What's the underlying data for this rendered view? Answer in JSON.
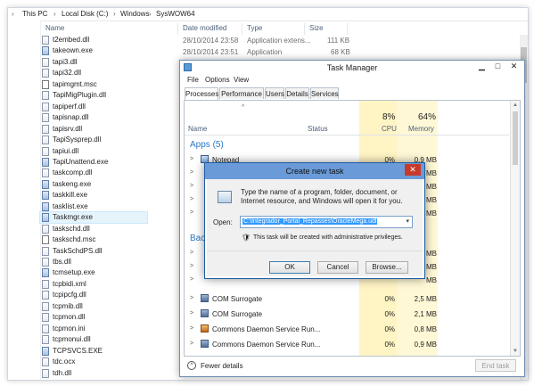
{
  "explorer": {
    "breadcrumb": [
      "This PC",
      "Local Disk (C:)",
      "Windows",
      "SysWOW64"
    ],
    "columns": {
      "name": "Name",
      "date": "Date modified",
      "type": "Type",
      "size": "Size"
    },
    "rows_with_details": [
      {
        "date": "28/10/2014 23:58",
        "type": "Application extens...",
        "size": "111 KB"
      },
      {
        "date": "28/10/2014 23:51",
        "type": "Application",
        "size": "68 KB"
      }
    ],
    "files": [
      "t2embed.dll",
      "takeown.exe",
      "tapi3.dll",
      "tapi32.dll",
      "tapimgmt.msc",
      "TapiMigPlugin.dll",
      "tapiperf.dll",
      "tapisnap.dll",
      "tapisrv.dll",
      "TapiSysprep.dll",
      "tapiui.dll",
      "TapiUnattend.exe",
      "taskcomp.dll",
      "taskeng.exe",
      "taskkill.exe",
      "tasklist.exe",
      "Taskmgr.exe",
      "taskschd.dll",
      "taskschd.msc",
      "TaskSchdPS.dll",
      "tbs.dll",
      "tcmsetup.exe",
      "tcpbidi.xml",
      "tcpipcfg.dll",
      "tcpmib.dll",
      "tcpmon.dll",
      "tcpmon.ini",
      "tcpmonui.dll",
      "TCPSVCS.EXE",
      "tdc.ocx",
      "tdh.dll"
    ],
    "selected_file": "Taskmgr.exe"
  },
  "taskmanager": {
    "title": "Task Manager",
    "menu": [
      "File",
      "Options",
      "View"
    ],
    "tabs": [
      "Processes",
      "Performance",
      "Users",
      "Details",
      "Services"
    ],
    "header": {
      "name": "Name",
      "status": "Status",
      "cpu_pct": "8%",
      "cpu": "CPU",
      "mem_pct": "64%",
      "mem": "Memory"
    },
    "apps_group": "Apps (5)",
    "background_group": "Bac",
    "processes_top": [
      {
        "name": "Notepad",
        "cpu": "0%",
        "mem": "0,9 MB"
      }
    ],
    "processes_partial": [
      {
        "cpu": "",
        "mem": "MB"
      },
      {
        "cpu": "",
        "mem": "MB"
      },
      {
        "cpu": "",
        "mem": "MB"
      },
      {
        "cpu": "",
        "mem": "MB"
      },
      {
        "cpu": "",
        "mem": "MB"
      },
      {
        "cpu": "",
        "mem": "MB"
      },
      {
        "cpu": "",
        "mem": "MB"
      }
    ],
    "processes_bottom": [
      {
        "name": "COM Surrogate",
        "cpu": "0%",
        "mem": "2,5 MB"
      },
      {
        "name": "COM Surrogate",
        "cpu": "0%",
        "mem": "2,1 MB"
      },
      {
        "name": "Commons Daemon Service Run...",
        "cpu": "0%",
        "mem": "0,8 MB"
      },
      {
        "name": "Commons Daemon Service Run...",
        "cpu": "0%",
        "mem": "0,9 MB"
      }
    ],
    "fewer_details": "Fewer details",
    "end_task": "End task"
  },
  "dialog": {
    "title": "Create new task",
    "description": "Type the name of a program, folder, document, or Internet resource, and Windows will open it for you.",
    "open_label": "Open:",
    "open_value": "C:\\Integrador_Portal_Repasses\\OracleMega.udl",
    "admin_note": "This task will be created with administrative privileges.",
    "ok": "OK",
    "cancel": "Cancel",
    "browse": "Browse..."
  }
}
